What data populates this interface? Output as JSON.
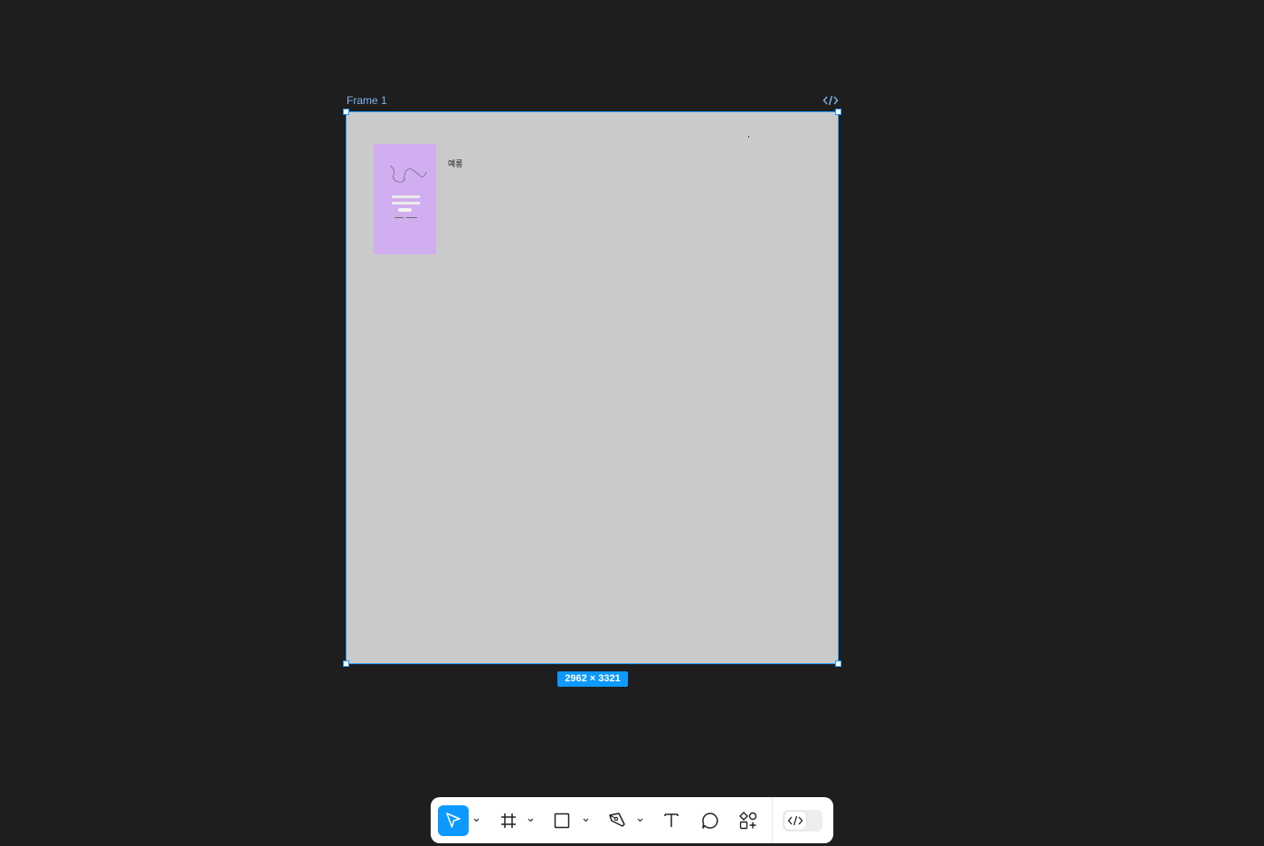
{
  "canvas": {
    "frame_name": "Frame 1",
    "frame_size_label": "2962 × 3321",
    "frame_text": "예롱",
    "frame_background": "#cacaca",
    "selection_color": "#0d99ff"
  },
  "thumbnail": {
    "background": "#d1aeef",
    "description_icon": "squiggle-illustration-icon"
  },
  "toolbar": {
    "tools": [
      {
        "name": "move-tool",
        "icon": "cursor-arrow-icon",
        "active": true
      },
      {
        "name": "frame-tool",
        "icon": "hash-frame-icon",
        "active": false
      },
      {
        "name": "shape-tool",
        "icon": "rectangle-icon",
        "active": false
      },
      {
        "name": "pen-tool",
        "icon": "pen-nib-icon",
        "active": false
      },
      {
        "name": "text-tool",
        "icon": "text-T-icon",
        "active": false
      },
      {
        "name": "comment-tool",
        "icon": "speech-bubble-icon",
        "active": false
      },
      {
        "name": "resources-tool",
        "icon": "shapes-plus-icon",
        "active": false
      }
    ],
    "dev_mode_icon": "code-brackets-icon"
  }
}
